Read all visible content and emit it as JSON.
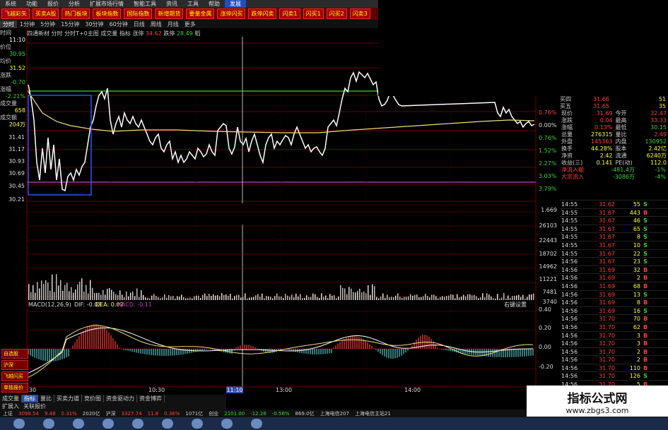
{
  "menubar": [
    "系统",
    "功能",
    "报价",
    "分析",
    "扩展市场行情",
    "智能工具",
    "资讯",
    "工具",
    "帮助",
    "发展"
  ],
  "quickbar": [
    "飞越彩矢",
    "买卖A股",
    "热门板块",
    "板块指数",
    "国际指数",
    "新增期货",
    "要量金属",
    "涨停闪买",
    "跌停闪卖",
    "闪卖1",
    "闪买1",
    "闪买2",
    "闪卖3"
  ],
  "periods": [
    "分时",
    "1分钟",
    "5分钟",
    "15分钟",
    "30分钟",
    "60分钟",
    "日线",
    "周线",
    "月线",
    "更多"
  ],
  "subbar": {
    "name": "四通新材",
    "labels": "分时 分时T+0主图 成交量 指标",
    "rise_label": "涨停",
    "rise_value": "34.62",
    "fall_label": "跌停",
    "fall_value": "28.49",
    "tail": "稻"
  },
  "sideinfo": {
    "time_label": "时间",
    "time_value": "11:10",
    "price_label": "价位",
    "price_value": "30.95",
    "avg_label": "均价",
    "avg_value": "31.52",
    "chg_label": "涨跌",
    "chg_value": "-0.70",
    "pct_label": "涨幅",
    "pct_value": "-2.21%",
    "vol_label": "成交量",
    "vol_value": "658",
    "amt_label": "成交额",
    "amt_value": "204万"
  },
  "price_axis_left": [
    "31.41",
    "31.17",
    "30.93",
    "30.69",
    "30.45",
    "30.21"
  ],
  "pct_axis_right": [
    "0.76%",
    "0.00%",
    "0.76%",
    "1.52%",
    "2.27%",
    "3.03%",
    "3.79%"
  ],
  "volume_axis": [
    "1.669",
    "26103",
    "22443",
    "18702",
    "14962",
    "11221",
    "7481",
    "3740"
  ],
  "macd": {
    "label": "MACD(12,26,9)",
    "dif": "DIF: -0.03",
    "dea": "DEA: 0.02",
    "macd": "MACD: -0.11",
    "right_label": "右键设置",
    "axis": [
      "0.40",
      "0.20",
      "0.00",
      "-0.20"
    ]
  },
  "time_axis": [
    "09:30",
    "10:30",
    "11:10",
    "13:00",
    "14:00"
  ],
  "leftbtns": [
    "自选股",
    "沪深",
    "飞越闪买",
    "单独报价"
  ],
  "bottomtabs": [
    "成交量",
    "指标",
    "量比",
    "买卖力道",
    "竞价图",
    "资金驱动力",
    "资金博弈"
  ],
  "bottomtabs2": [
    "扩展入",
    "关联报价"
  ],
  "status": [
    {
      "t": "上证",
      "c": ""
    },
    {
      "t": "3098.54",
      "c": "up"
    },
    {
      "t": "9.48",
      "c": "up"
    },
    {
      "t": "0.31%",
      "c": "up"
    },
    {
      "t": "2020亿",
      "c": ""
    },
    {
      "t": "沪深",
      "c": ""
    },
    {
      "t": "3327.74",
      "c": "up"
    },
    {
      "t": "11.8",
      "c": "up"
    },
    {
      "t": "0.36%",
      "c": "up"
    },
    {
      "t": "1071亿",
      "c": ""
    },
    {
      "t": "创业",
      "c": ""
    },
    {
      "t": "2101.00",
      "c": "down"
    },
    {
      "t": "-12.26",
      "c": "down"
    },
    {
      "t": "-0.56%",
      "c": "down"
    },
    {
      "t": "869.0亿",
      "c": ""
    },
    {
      "t": "上海电信207",
      "c": ""
    },
    {
      "t": "上海电信主站21",
      "c": ""
    }
  ],
  "orderbook": [
    {
      "label": "买四",
      "price": "31.66",
      "vol": "51"
    },
    {
      "label": "买五",
      "price": "31.65",
      "vol": "35"
    }
  ],
  "quote_kv": [
    [
      "现价",
      "31.69",
      "今开",
      "32.47"
    ],
    [
      "涨跌",
      "0.04",
      "最高",
      "33.33"
    ],
    [
      "涨幅",
      "0.13%",
      "最低",
      "30.15"
    ],
    [
      "总量",
      "276315",
      "量比",
      "2.49"
    ],
    [
      "外盘",
      "145363",
      "内盘",
      "130952"
    ],
    [
      "换手",
      "44.28%",
      "股本",
      "2.42亿"
    ],
    [
      "净资",
      "2.42",
      "流通",
      "6240万"
    ],
    [
      "收益(三)",
      "0.141",
      "PE(动)",
      "112.0"
    ]
  ],
  "flows": [
    {
      "k": "净流入额",
      "v1": "-481.4万",
      "v2": "-1%",
      "c": "green"
    },
    {
      "k": "大宗流入",
      "v1": "-3086万",
      "v2": "-4%",
      "c": "green"
    }
  ],
  "ticks": [
    {
      "t": "14:55",
      "p": "31.62",
      "v": "55",
      "s": "S"
    },
    {
      "t": "14:55",
      "p": "31.67",
      "v": "443",
      "s": "B"
    },
    {
      "t": "14:55",
      "p": "31.67",
      "v": "46",
      "s": "S"
    },
    {
      "t": "14:55",
      "p": "31.67",
      "v": "65",
      "s": "S"
    },
    {
      "t": "14:55",
      "p": "31.67",
      "v": "8",
      "s": "S"
    },
    {
      "t": "14:55",
      "p": "31.67",
      "v": "10",
      "s": "S"
    },
    {
      "t": "14:55",
      "p": "31.67",
      "v": "22",
      "s": "S"
    },
    {
      "t": "14:56",
      "p": "31.67",
      "v": "23",
      "s": "S"
    },
    {
      "t": "14:56",
      "p": "31.69",
      "v": "32",
      "s": "B"
    },
    {
      "t": "14:56",
      "p": "31.69",
      "v": "2",
      "s": "B"
    },
    {
      "t": "14:56",
      "p": "31.69",
      "v": "68",
      "s": "B"
    },
    {
      "t": "14:56",
      "p": "31.69",
      "v": "13",
      "s": "S"
    },
    {
      "t": "14:56",
      "p": "31.69",
      "v": "8",
      "s": "B"
    },
    {
      "t": "14:56",
      "p": "31.69",
      "v": "16",
      "s": "S"
    },
    {
      "t": "14:56",
      "p": "31.70",
      "v": "70",
      "s": "B"
    },
    {
      "t": "14:56",
      "p": "31.70",
      "v": "62",
      "s": "B"
    },
    {
      "t": "14:56",
      "p": "31.70",
      "v": "3",
      "s": "B"
    },
    {
      "t": "14:56",
      "p": "31.70",
      "v": "3",
      "s": "B"
    },
    {
      "t": "14:56",
      "p": "31.70",
      "v": "2",
      "s": "B"
    },
    {
      "t": "14:56",
      "p": "31.70",
      "v": "2",
      "s": "B"
    },
    {
      "t": "14:56",
      "p": "31.70",
      "v": "110",
      "s": "B"
    },
    {
      "t": "14:56",
      "p": "31.70",
      "v": "126",
      "s": "S"
    },
    {
      "t": "14:56",
      "p": "31.70",
      "v": "5",
      "s": "B"
    }
  ],
  "watermark": {
    "title": "指标公式网",
    "url": "www.zbgs3.com"
  },
  "colors": {
    "up": "#ff4040",
    "down": "#3cd23c",
    "grid": "#8b0000",
    "avg": "#e8e07a"
  }
}
